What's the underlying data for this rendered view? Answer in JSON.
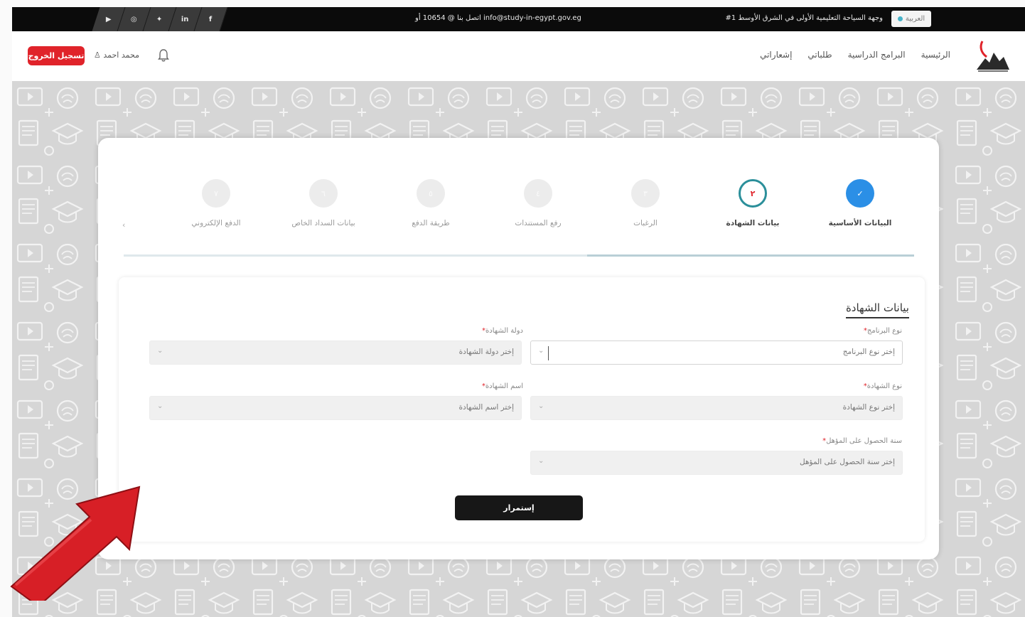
{
  "topbar": {
    "lang_label": "العربية",
    "tagline": "#1 وجهة السياحة التعليمية الأولى في الشرق الأوسط",
    "contact": "اتصل بنا @ 10654 أو info@study-in-egypt.gov.eg",
    "social_icons": [
      "youtube-icon",
      "instagram-icon",
      "twitter-icon",
      "linkedin-icon",
      "facebook-icon"
    ],
    "social_glyphs": [
      "▶",
      "◎",
      "✦",
      "in",
      "f"
    ]
  },
  "header": {
    "nav": [
      "الرئيسية",
      "البرامج الدراسية",
      "طلباتي",
      "إشعاراتي"
    ],
    "user_name": "محمد احمد",
    "logout_label": "تسجيل الخروج"
  },
  "stepper": {
    "steps": [
      {
        "label": "البيانات الأساسية",
        "state": "done",
        "mark": "✓"
      },
      {
        "label": "بيانات الشهادة",
        "state": "active",
        "mark": "٢"
      },
      {
        "label": "الرغبات",
        "state": "pending",
        "mark": "٣"
      },
      {
        "label": "رفع المستندات",
        "state": "pending",
        "mark": "٤"
      },
      {
        "label": "طريقة الدفع",
        "state": "pending",
        "mark": "٥"
      },
      {
        "label": "بيانات السداد الخاص",
        "state": "pending",
        "mark": "٦"
      },
      {
        "label": "الدفع الإلكتروني",
        "state": "pending",
        "mark": "٧"
      }
    ]
  },
  "form": {
    "section_title": "بيانات الشهادة",
    "program_type": {
      "label": "نوع البرنامج",
      "placeholder": "إختر نوع البرنامج"
    },
    "certificate_country": {
      "label": "دولة الشهادة",
      "placeholder": "إختر دولة الشهادة"
    },
    "certificate_type": {
      "label": "نوع الشهادة",
      "placeholder": "إختر نوع الشهادة"
    },
    "certificate_name": {
      "label": "اسم الشهادة",
      "placeholder": "إختر اسم الشهادة"
    },
    "qualification_year": {
      "label": "سنة الحصول على المؤهل",
      "placeholder": "إختر سنة الحصول على المؤهل"
    },
    "required_mark": "*",
    "continue_label": "إستمرار"
  },
  "colors": {
    "accent_red": "#e0232a",
    "step_done": "#2b8fe6",
    "step_active_ring": "#2b8f9a",
    "arrow_red": "#d71f26"
  }
}
